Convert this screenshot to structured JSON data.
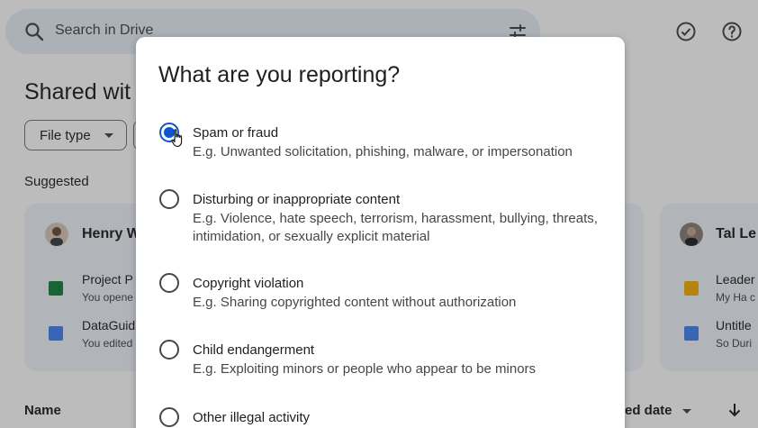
{
  "search": {
    "placeholder": "Search in Drive"
  },
  "page": {
    "title": "Shared wit",
    "filter_chip": "File type",
    "suggested_label": "Suggested"
  },
  "cards": {
    "left": {
      "person": "Henry W",
      "files": [
        {
          "title": "Project P",
          "sub": "You opene",
          "icon": "sheets-icon",
          "color": "#188038"
        },
        {
          "title": "DataGuid",
          "sub": "You edited",
          "icon": "docs-icon",
          "color": "#4285f4"
        }
      ]
    },
    "right": {
      "person": "Tal Le",
      "files": [
        {
          "title": "Leader",
          "sub": "My Ha c",
          "icon": "slides-icon",
          "color": "#f4b400"
        },
        {
          "title": "Untitle",
          "sub": "So Duri",
          "icon": "docs-icon",
          "color": "#4285f4"
        }
      ]
    }
  },
  "list_header": {
    "name": "Name",
    "date": "ed date"
  },
  "dialog": {
    "title": "What are you reporting?",
    "options": [
      {
        "label": "Spam or fraud",
        "desc": "E.g. Unwanted solicitation, phishing, malware, or impersonation",
        "checked": true
      },
      {
        "label": "Disturbing or inappropriate content",
        "desc": "E.g. Violence, hate speech, terrorism, harassment, bullying, threats, intimidation, or sexually explicit material",
        "checked": false
      },
      {
        "label": "Copyright violation",
        "desc": "E.g. Sharing copyrighted content without authorization",
        "checked": false
      },
      {
        "label": "Child endangerment",
        "desc": "E.g. Exploiting minors or people who appear to be minors",
        "checked": false
      },
      {
        "label": "Other illegal activity",
        "desc": "",
        "checked": false
      }
    ]
  },
  "colors": {
    "accent": "#0b57d0",
    "scrim": "rgba(32,33,36,0.30)"
  }
}
